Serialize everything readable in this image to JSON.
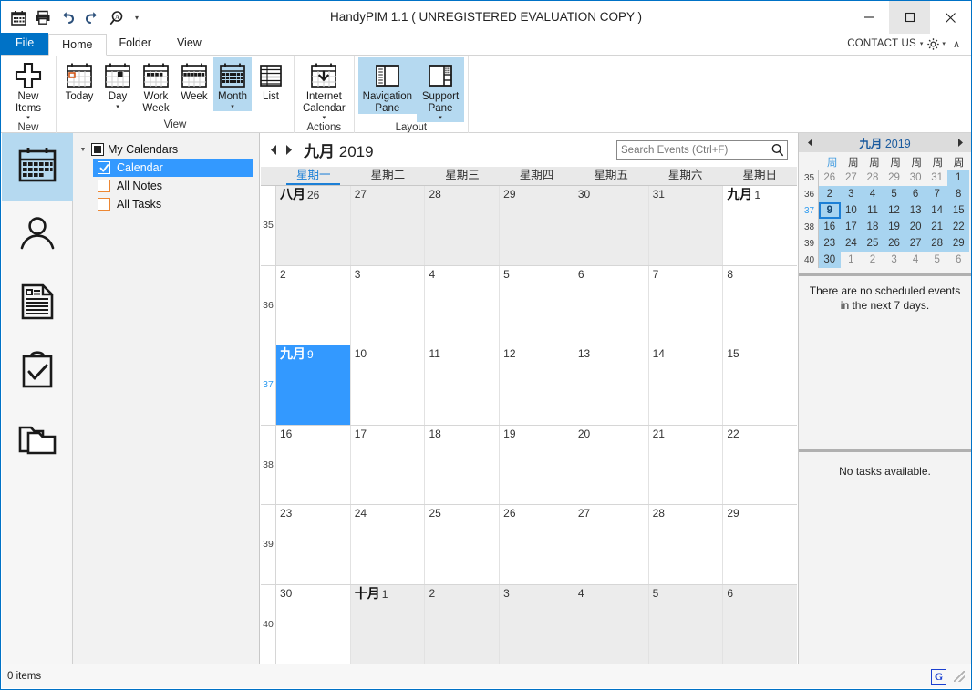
{
  "window": {
    "title": "HandyPIM 1.1 ( UNREGISTERED EVALUATION COPY )",
    "minimize_label": "Minimize",
    "maximize_label": "Maximize",
    "close_label": "Close"
  },
  "quick_access": [
    {
      "name": "calendar-icon",
      "label": "Calendar"
    },
    {
      "name": "print-icon",
      "label": "Print"
    },
    {
      "name": "undo-icon",
      "label": "Undo"
    },
    {
      "name": "redo-icon",
      "label": "Redo"
    },
    {
      "name": "find-icon",
      "label": "Find"
    },
    {
      "name": "customize-caret-icon",
      "label": "Customize Quick Access Toolbar"
    }
  ],
  "tabs": [
    {
      "label": "File",
      "kind": "file"
    },
    {
      "label": "Home",
      "kind": "active"
    },
    {
      "label": "Folder",
      "kind": "normal"
    },
    {
      "label": "View",
      "kind": "normal"
    }
  ],
  "tabstrip_right": {
    "contact_us": "CONTACT US",
    "caret": "▾",
    "chevron_up": "∧"
  },
  "ribbon": {
    "groups": [
      {
        "label": "New",
        "buttons": [
          {
            "label": "New\nItems",
            "icon": "plus-icon",
            "dropdown": true,
            "selected": false,
            "size": "big"
          }
        ]
      },
      {
        "label": "View",
        "buttons": [
          {
            "label": "Today",
            "icon": "today-calendar-icon",
            "dropdown": false,
            "selected": false
          },
          {
            "label": "Day",
            "icon": "day-calendar-icon",
            "dropdown": true,
            "selected": false
          },
          {
            "label": "Work\nWeek",
            "icon": "work-week-calendar-icon",
            "dropdown": false,
            "selected": false
          },
          {
            "label": "Week",
            "icon": "week-calendar-icon",
            "dropdown": false,
            "selected": false
          },
          {
            "label": "Month",
            "icon": "month-calendar-icon",
            "dropdown": true,
            "selected": true
          },
          {
            "label": "List",
            "icon": "list-icon",
            "dropdown": false,
            "selected": false
          }
        ]
      },
      {
        "label": "Actions",
        "buttons": [
          {
            "label": "Internet\nCalendar",
            "icon": "internet-calendar-icon",
            "dropdown": true,
            "selected": false,
            "size": "big"
          }
        ]
      },
      {
        "label": "Layout",
        "buttons": [
          {
            "label": "Navigation\nPane",
            "icon": "navigation-pane-icon",
            "dropdown": false,
            "selected": true,
            "size": "big"
          },
          {
            "label": "Support\nPane",
            "icon": "support-pane-icon",
            "dropdown": true,
            "selected": true,
            "size": "big"
          }
        ]
      }
    ]
  },
  "iconbar": [
    {
      "name": "calendar-module-icon",
      "label": "Calendar",
      "selected": true
    },
    {
      "name": "contacts-module-icon",
      "label": "Contacts",
      "selected": false
    },
    {
      "name": "notes-module-icon",
      "label": "Notes",
      "selected": false
    },
    {
      "name": "tasks-module-icon",
      "label": "Tasks",
      "selected": false
    },
    {
      "name": "folders-module-icon",
      "label": "Folders",
      "selected": false
    }
  ],
  "navpane": {
    "root_label": "My Calendars",
    "items": [
      {
        "label": "Calendar",
        "checked": true,
        "selected": true,
        "color": "#3399ff"
      },
      {
        "label": "All Notes",
        "checked": false,
        "selected": false,
        "color": "#ed8733"
      },
      {
        "label": "All Tasks",
        "checked": false,
        "selected": false,
        "color": "#ed8733"
      }
    ]
  },
  "calendar": {
    "prev_label": "Previous",
    "next_label": "Next",
    "month": "九月",
    "year": "2019",
    "search_placeholder": "Search Events (Ctrl+F)",
    "search_value": "",
    "day_headers": [
      "星期一",
      "星期二",
      "星期三",
      "星期四",
      "星期五",
      "星期六",
      "星期日"
    ],
    "selected_day_header_index": 0,
    "week_numbers": [
      "35",
      "36",
      "37",
      "38",
      "39",
      "40"
    ],
    "selected_week_index": 2,
    "weeks": [
      [
        {
          "month": "八月",
          "day": "26",
          "other": true,
          "selected": false
        },
        {
          "month": "",
          "day": "27",
          "other": true,
          "selected": false
        },
        {
          "month": "",
          "day": "28",
          "other": true,
          "selected": false
        },
        {
          "month": "",
          "day": "29",
          "other": true,
          "selected": false
        },
        {
          "month": "",
          "day": "30",
          "other": true,
          "selected": false
        },
        {
          "month": "",
          "day": "31",
          "other": true,
          "selected": false
        },
        {
          "month": "九月",
          "day": "1",
          "other": false,
          "selected": false
        }
      ],
      [
        {
          "month": "",
          "day": "2",
          "other": false,
          "selected": false
        },
        {
          "month": "",
          "day": "3",
          "other": false,
          "selected": false
        },
        {
          "month": "",
          "day": "4",
          "other": false,
          "selected": false
        },
        {
          "month": "",
          "day": "5",
          "other": false,
          "selected": false
        },
        {
          "month": "",
          "day": "6",
          "other": false,
          "selected": false
        },
        {
          "month": "",
          "day": "7",
          "other": false,
          "selected": false
        },
        {
          "month": "",
          "day": "8",
          "other": false,
          "selected": false
        }
      ],
      [
        {
          "month": "九月",
          "day": "9",
          "other": false,
          "selected": true
        },
        {
          "month": "",
          "day": "10",
          "other": false,
          "selected": false
        },
        {
          "month": "",
          "day": "11",
          "other": false,
          "selected": false
        },
        {
          "month": "",
          "day": "12",
          "other": false,
          "selected": false
        },
        {
          "month": "",
          "day": "13",
          "other": false,
          "selected": false
        },
        {
          "month": "",
          "day": "14",
          "other": false,
          "selected": false
        },
        {
          "month": "",
          "day": "15",
          "other": false,
          "selected": false
        }
      ],
      [
        {
          "month": "",
          "day": "16",
          "other": false,
          "selected": false
        },
        {
          "month": "",
          "day": "17",
          "other": false,
          "selected": false
        },
        {
          "month": "",
          "day": "18",
          "other": false,
          "selected": false
        },
        {
          "month": "",
          "day": "19",
          "other": false,
          "selected": false
        },
        {
          "month": "",
          "day": "20",
          "other": false,
          "selected": false
        },
        {
          "month": "",
          "day": "21",
          "other": false,
          "selected": false
        },
        {
          "month": "",
          "day": "22",
          "other": false,
          "selected": false
        }
      ],
      [
        {
          "month": "",
          "day": "23",
          "other": false,
          "selected": false
        },
        {
          "month": "",
          "day": "24",
          "other": false,
          "selected": false
        },
        {
          "month": "",
          "day": "25",
          "other": false,
          "selected": false
        },
        {
          "month": "",
          "day": "26",
          "other": false,
          "selected": false
        },
        {
          "month": "",
          "day": "27",
          "other": false,
          "selected": false
        },
        {
          "month": "",
          "day": "28",
          "other": false,
          "selected": false
        },
        {
          "month": "",
          "day": "29",
          "other": false,
          "selected": false
        }
      ],
      [
        {
          "month": "",
          "day": "30",
          "other": false,
          "selected": false
        },
        {
          "month": "十月",
          "day": "1",
          "other": true,
          "selected": false
        },
        {
          "month": "",
          "day": "2",
          "other": true,
          "selected": false
        },
        {
          "month": "",
          "day": "3",
          "other": true,
          "selected": false
        },
        {
          "month": "",
          "day": "4",
          "other": true,
          "selected": false
        },
        {
          "month": "",
          "day": "5",
          "other": true,
          "selected": false
        },
        {
          "month": "",
          "day": "6",
          "other": true,
          "selected": false
        }
      ]
    ]
  },
  "support_pane": {
    "mini": {
      "prev_label": "Previous month",
      "next_label": "Next month",
      "month": "九月",
      "year": "2019",
      "day_headers": [
        "周",
        "周",
        "周",
        "周",
        "周",
        "周",
        "周"
      ],
      "week_numbers": [
        "35",
        "36",
        "37",
        "38",
        "39",
        "40"
      ],
      "selected_week_index": 2,
      "today": "9",
      "rows": [
        [
          {
            "d": "26",
            "inmonth": false
          },
          {
            "d": "27",
            "inmonth": false
          },
          {
            "d": "28",
            "inmonth": false
          },
          {
            "d": "29",
            "inmonth": false
          },
          {
            "d": "30",
            "inmonth": false
          },
          {
            "d": "31",
            "inmonth": false
          },
          {
            "d": "1",
            "inmonth": true
          }
        ],
        [
          {
            "d": "2",
            "inmonth": true
          },
          {
            "d": "3",
            "inmonth": true
          },
          {
            "d": "4",
            "inmonth": true
          },
          {
            "d": "5",
            "inmonth": true
          },
          {
            "d": "6",
            "inmonth": true
          },
          {
            "d": "7",
            "inmonth": true
          },
          {
            "d": "8",
            "inmonth": true
          }
        ],
        [
          {
            "d": "9",
            "inmonth": true
          },
          {
            "d": "10",
            "inmonth": true
          },
          {
            "d": "11",
            "inmonth": true
          },
          {
            "d": "12",
            "inmonth": true
          },
          {
            "d": "13",
            "inmonth": true
          },
          {
            "d": "14",
            "inmonth": true
          },
          {
            "d": "15",
            "inmonth": true
          }
        ],
        [
          {
            "d": "16",
            "inmonth": true
          },
          {
            "d": "17",
            "inmonth": true
          },
          {
            "d": "18",
            "inmonth": true
          },
          {
            "d": "19",
            "inmonth": true
          },
          {
            "d": "20",
            "inmonth": true
          },
          {
            "d": "21",
            "inmonth": true
          },
          {
            "d": "22",
            "inmonth": true
          }
        ],
        [
          {
            "d": "23",
            "inmonth": true
          },
          {
            "d": "24",
            "inmonth": true
          },
          {
            "d": "25",
            "inmonth": true
          },
          {
            "d": "26",
            "inmonth": true
          },
          {
            "d": "27",
            "inmonth": true
          },
          {
            "d": "28",
            "inmonth": true
          },
          {
            "d": "29",
            "inmonth": true
          }
        ],
        [
          {
            "d": "30",
            "inmonth": true
          },
          {
            "d": "1",
            "inmonth": false
          },
          {
            "d": "2",
            "inmonth": false
          },
          {
            "d": "3",
            "inmonth": false
          },
          {
            "d": "4",
            "inmonth": false
          },
          {
            "d": "5",
            "inmonth": false
          },
          {
            "d": "6",
            "inmonth": false
          }
        ]
      ]
    },
    "events_empty": "There are no scheduled events in the next 7 days.",
    "tasks_empty": "No tasks available."
  },
  "statusbar": {
    "items_text": "0 items",
    "badge": "G"
  },
  "colors": {
    "accent": "#0072c6",
    "selection": "#3399ff",
    "ribbon_selected": "#b5d9f0",
    "mini_inmonth": "#a8d4f0",
    "orange": "#ed8733"
  }
}
